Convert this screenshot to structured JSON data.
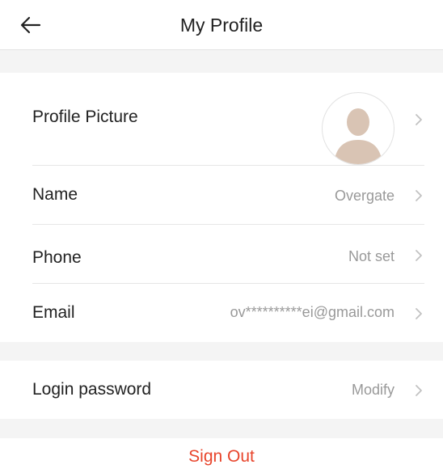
{
  "header": {
    "title": "My Profile",
    "back_icon": "arrow-left-icon"
  },
  "profile": {
    "picture_label": "Profile Picture",
    "name_label": "Name",
    "name_value": "Overgate",
    "phone_label": "Phone",
    "phone_value": "Not set",
    "email_label": "Email",
    "email_value": "ov**********ei@gmail.com"
  },
  "security": {
    "password_label": "Login password",
    "password_value": "Modify"
  },
  "actions": {
    "signout_label": "Sign Out"
  },
  "colors": {
    "accent": "#e8452c",
    "gap_background": "#f4f4f4",
    "muted_text": "#999999",
    "avatar_fill": "#d9c4b4"
  }
}
